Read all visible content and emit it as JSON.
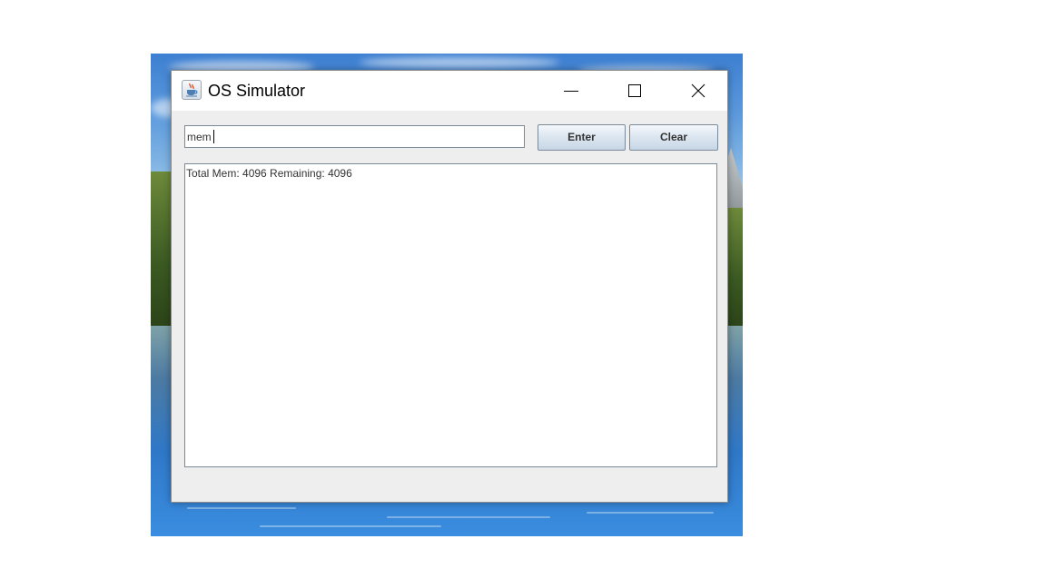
{
  "window": {
    "title": "OS Simulator",
    "icon": "java-coffee-cup-icon"
  },
  "caption_buttons": {
    "minimize_icon": "minimize-icon",
    "maximize_icon": "maximize-icon",
    "close_icon": "close-icon"
  },
  "command": {
    "value": "mem",
    "placeholder": ""
  },
  "buttons": {
    "enter_label": "Enter",
    "clear_label": "Clear"
  },
  "output": {
    "lines": [
      "Total Mem: 4096 Remaining: 4096"
    ]
  },
  "colors": {
    "window_bg": "#eeeeee",
    "titlebar_bg": "#ffffff",
    "button_gradient_top": "#f4f8fc",
    "button_gradient_bottom": "#c7d6e5",
    "border": "#7a8a99"
  }
}
